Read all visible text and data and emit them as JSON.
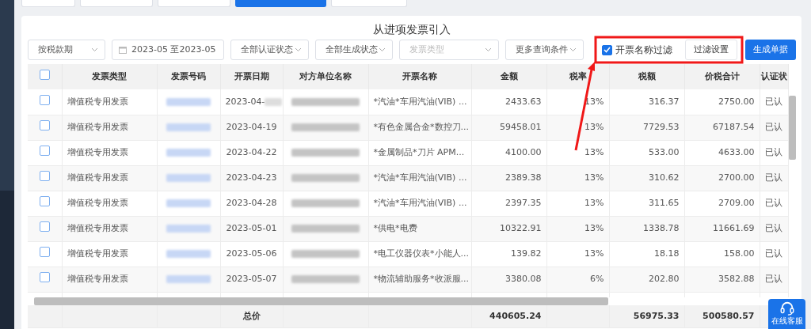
{
  "top_tabs": [
    {
      "selected": false
    },
    {
      "selected": false
    },
    {
      "selected": false
    },
    {
      "selected": true
    },
    {
      "selected": false
    }
  ],
  "title": "从进项发票引入",
  "filters": [
    {
      "kind": "select",
      "value": "按税款期"
    },
    {
      "kind": "date-range",
      "value": "2023-05  至2023-05"
    },
    {
      "kind": "select",
      "value": "全部认证状态"
    },
    {
      "kind": "select",
      "value": "全部生成状态"
    },
    {
      "kind": "select",
      "placeholder": "发票类型"
    },
    {
      "kind": "select",
      "value": "更多查询条件"
    }
  ],
  "name_filter": {
    "label": "开票名称过滤",
    "checked": true
  },
  "filter_settings_button": "过滤设置",
  "generate_button": "生成单据",
  "table": {
    "header_checked": false,
    "columns": [
      "发票类型",
      "发票号码",
      "开票日期",
      "对方单位名称",
      "开票名称",
      "金额",
      "税率",
      "税额",
      "价税合计",
      "认证状"
    ],
    "rows": [
      {
        "checked": false,
        "cells": [
          "增值税专用发票",
          {
            "kind": "redacted"
          },
          {
            "kind": "partly-redacted",
            "text": "2023-04-"
          },
          {
            "kind": "redacted"
          },
          "*汽油*车用汽油(VIB) ...",
          "2433.63",
          "13%",
          "316.37",
          "2750.00",
          "已认"
        ]
      },
      {
        "checked": false,
        "cells": [
          "增值税专用发票",
          {
            "kind": "redacted"
          },
          "2023-04-19",
          {
            "kind": "redacted"
          },
          "*有色金属合金*数控刀...",
          "59458.01",
          "13%",
          "7729.53",
          "67187.54",
          "已认"
        ]
      },
      {
        "checked": false,
        "cells": [
          "增值税专用发票",
          {
            "kind": "redacted"
          },
          "2023-04-22",
          {
            "kind": "redacted"
          },
          "*金属制品*刀片 APM...",
          "4100.00",
          "13%",
          "533.00",
          "4633.00",
          "已认"
        ]
      },
      {
        "checked": false,
        "cells": [
          "增值税专用发票",
          {
            "kind": "redacted"
          },
          "2023-04-23",
          {
            "kind": "redacted"
          },
          "*汽油*车用汽油(VIB) ...",
          "2389.38",
          "13%",
          "310.62",
          "2700.00",
          "已认"
        ]
      },
      {
        "checked": false,
        "cells": [
          "增值税专用发票",
          {
            "kind": "redacted"
          },
          "2023-04-28",
          {
            "kind": "redacted"
          },
          "*汽油*车用汽油(VIB) ...",
          "2397.35",
          "13%",
          "311.65",
          "2709.00",
          "已认"
        ]
      },
      {
        "checked": false,
        "cells": [
          "增值税专用发票",
          {
            "kind": "redacted"
          },
          "2023-05-01",
          {
            "kind": "redacted"
          },
          "*供电*电费",
          "10322.91",
          "13%",
          "1338.78",
          "11661.69",
          "已认"
        ]
      },
      {
        "checked": false,
        "cells": [
          "增值税专用发票",
          {
            "kind": "redacted"
          },
          "2023-05-06",
          {
            "kind": "redacted"
          },
          "*电工仪器仪表*小能人...",
          "139.82",
          "13%",
          "18.18",
          "158.00",
          "已认"
        ]
      },
      {
        "checked": false,
        "cells": [
          "增值税专用发票",
          {
            "kind": "redacted"
          },
          "2023-05-07",
          {
            "kind": "redacted"
          },
          "*物流辅助服务*收派服...",
          "3380.08",
          "6%",
          "202.80",
          "3582.88",
          "已认"
        ]
      }
    ],
    "footer": {
      "label": "总价",
      "amount": "440605.24",
      "tax": "56975.33",
      "total": "500580.57"
    }
  },
  "online_service": "在线客服"
}
